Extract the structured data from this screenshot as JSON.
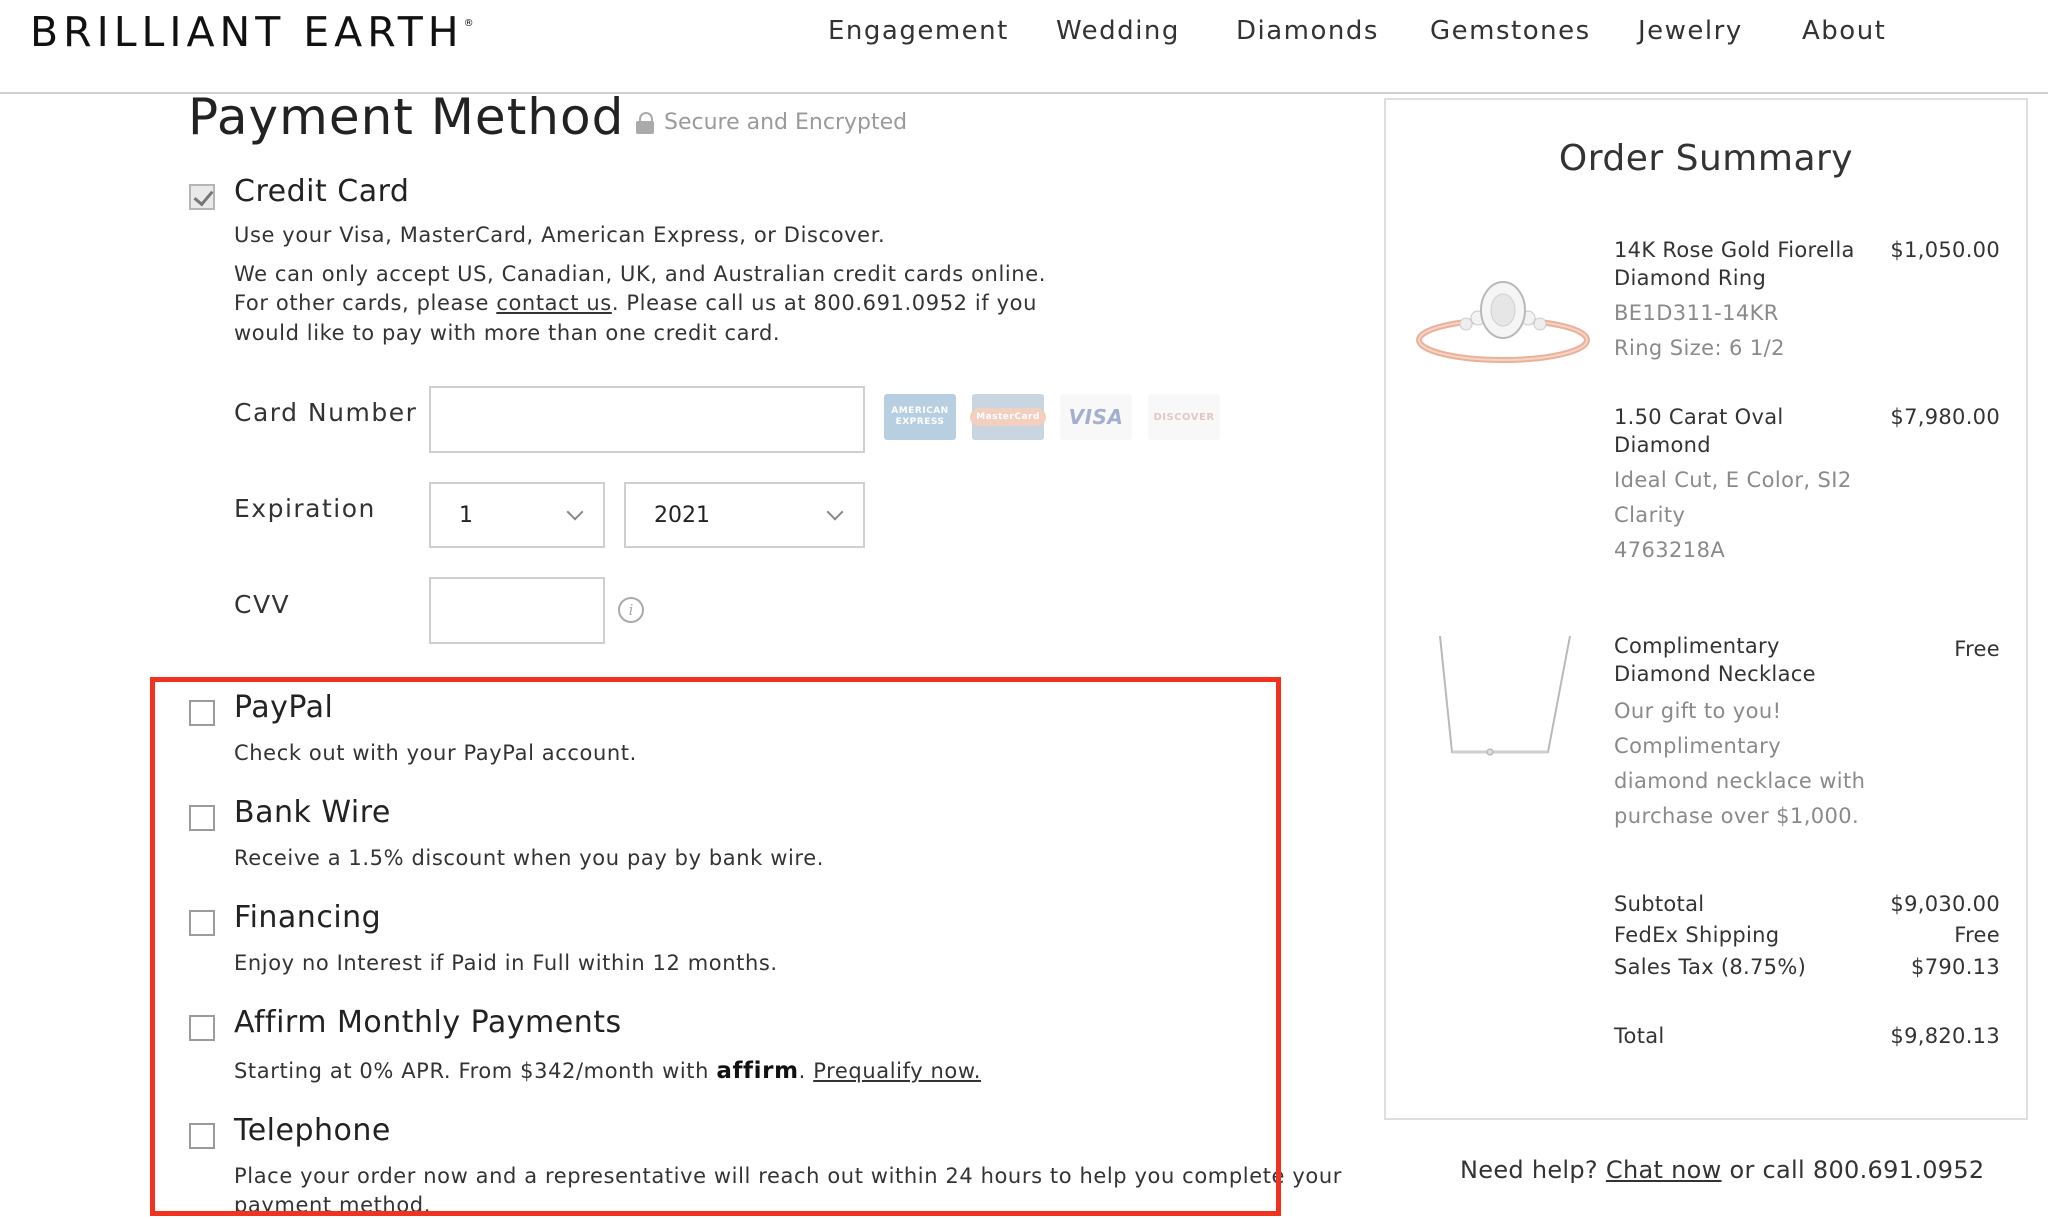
{
  "header": {
    "logo": "BRILLIANT EARTH",
    "logo_mark": "®",
    "nav": [
      "Engagement",
      "Wedding",
      "Diamonds",
      "Gemstones",
      "Jewelry",
      "About"
    ]
  },
  "payment": {
    "title": "Payment Method",
    "secure_text": "Secure and Encrypted",
    "credit_card": {
      "title": "Credit Card",
      "checked": true,
      "desc1": "Use your Visa, MasterCard, American Express, or Discover.",
      "desc2a": "We can only accept US, Canadian, UK, and Australian credit cards online.",
      "desc2b_pre": "For other cards, please ",
      "desc2b_link": "contact us",
      "desc2b_post": ". Please call us at 800.691.0952 if you",
      "desc2c": "would like to pay with more than one credit card.",
      "card_number_label": "Card Number",
      "card_number_value": "",
      "expiration_label": "Expiration",
      "exp_month": "1",
      "exp_year": "2021",
      "cvv_label": "CVV",
      "cvv_value": "",
      "card_logos": [
        "AMERICAN EXPRESS",
        "MasterCard",
        "VISA",
        "DISCOVER"
      ],
      "info_glyph": "i"
    },
    "options": [
      {
        "title": "PayPal",
        "desc": "Check out with your PayPal account."
      },
      {
        "title": "Bank Wire",
        "desc": "Receive a 1.5% discount when you pay by bank wire."
      },
      {
        "title": "Financing",
        "desc": "Enjoy no Interest if Paid in Full within 12 months."
      },
      {
        "title": "Affirm Monthly Payments",
        "desc_pre": "Starting at 0% APR. From $342/month with ",
        "brand": "affirm",
        "desc_post": ". ",
        "link": "Prequalify now."
      },
      {
        "title": "Telephone",
        "desc_line1": "Place your order now and a representative will reach out within 24 hours to help you complete your",
        "desc_line2": "payment method."
      }
    ],
    "highlight_color": "#f2311f"
  },
  "summary": {
    "title": "Order Summary",
    "items": [
      {
        "name1": "14K Rose Gold Fiorella",
        "name2": "Diamond Ring",
        "price": "$1,050.00",
        "sub1": "BE1D311-14KR",
        "sub2": "Ring Size: 6 1/2"
      },
      {
        "name1": "1.50 Carat Oval",
        "name2": "Diamond",
        "price": "$7,980.00",
        "sub1": "Ideal Cut, E Color, SI2",
        "sub2": "Clarity",
        "sub3": "4763218A"
      },
      {
        "name1": "Complimentary",
        "name2": "Diamond Necklace",
        "price": "Free",
        "sub1": "Our gift to you!",
        "sub2": "Complimentary",
        "sub3": "diamond necklace with",
        "sub4": "purchase over $1,000."
      }
    ],
    "subtotal_label": "Subtotal",
    "subtotal": "$9,030.00",
    "shipping_label": "FedEx Shipping",
    "shipping": "Free",
    "tax_label": "Sales Tax (8.75%)",
    "tax": "$790.13",
    "total_label": "Total",
    "total": "$9,820.13"
  },
  "help": {
    "pre": "Need help? ",
    "link": "Chat now",
    "post": " or call 800.691.0952"
  }
}
